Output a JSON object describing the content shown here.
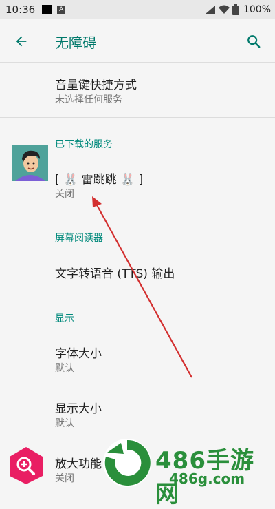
{
  "status_bar": {
    "time": "10:36",
    "app_icon_letter": "A",
    "battery": "100%"
  },
  "app_bar": {
    "title": "无障碍",
    "back_icon": "arrow-left-icon",
    "search_icon": "search-icon"
  },
  "items": {
    "volume_shortcut": {
      "title": "音量键快捷方式",
      "subtitle": "未选择任何服务"
    },
    "downloaded_header": "已下载的服务",
    "service": {
      "title": "[ 🐰 雷跳跳 🐰 ]",
      "subtitle": "关闭"
    },
    "screen_reader_header": "屏幕阅读器",
    "tts": {
      "title": "文字转语音 (TTS) 输出"
    },
    "display_header": "显示",
    "font_size": {
      "title": "字体大小",
      "subtitle": "默认"
    },
    "display_size": {
      "title": "显示大小",
      "subtitle": "默认"
    },
    "magnification": {
      "title": "放大功能",
      "subtitle": "关闭"
    }
  },
  "watermark": {
    "brand": "486手游网",
    "url": "486g.com"
  },
  "colors": {
    "accent": "#00796b",
    "section": "#00897b",
    "annotation_arrow": "#d32f2f",
    "magnify_icon": "#e91e63",
    "watermark": "#2a8f3b"
  }
}
